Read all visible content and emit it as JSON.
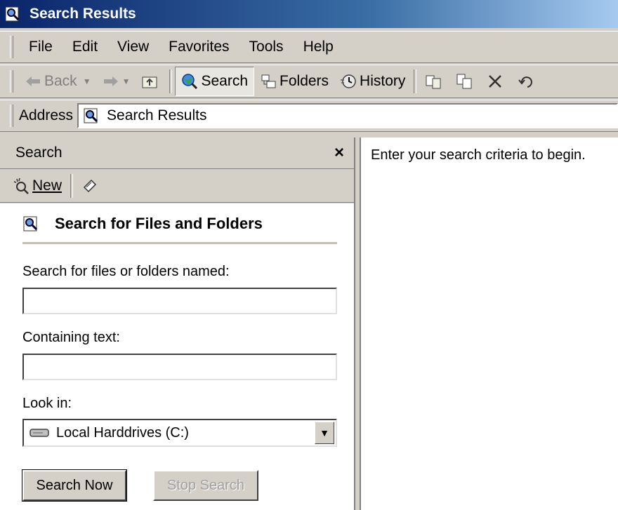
{
  "window": {
    "title": "Search Results"
  },
  "menu": {
    "items": [
      "File",
      "Edit",
      "View",
      "Favorites",
      "Tools",
      "Help"
    ]
  },
  "toolbar": {
    "back": "Back",
    "search": "Search",
    "folders": "Folders",
    "history": "History"
  },
  "address": {
    "label": "Address",
    "value": "Search Results"
  },
  "search_pane": {
    "title": "Search",
    "close": "×",
    "new_label": "New",
    "heading": "Search for Files and Folders",
    "named_label": "Search for files or folders named:",
    "named_value": "",
    "containing_label": "Containing text:",
    "containing_value": "",
    "lookin_label": "Look in:",
    "lookin_value": "Local Harddrives (C:)",
    "search_now": "Search Now",
    "stop_search": "Stop Search"
  },
  "results": {
    "message": "Enter your search criteria to begin."
  }
}
